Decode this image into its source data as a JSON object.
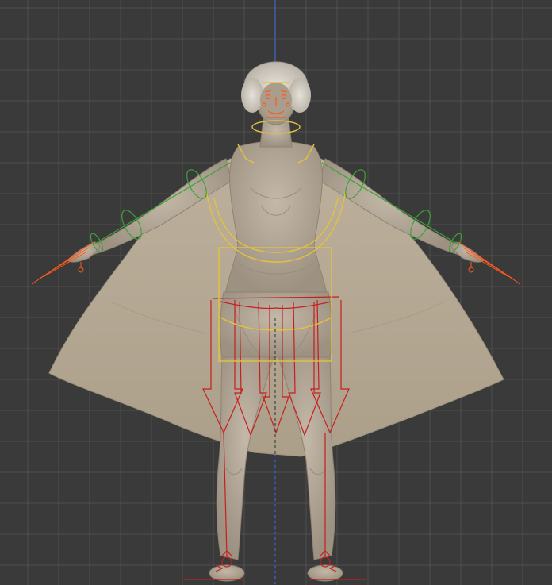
{
  "viewport": {
    "view": "front-orthographic",
    "background_color": "#3a3a3a",
    "grid_color": "#4f4f4f",
    "z_axis_color": "#3b5fa8"
  },
  "model": {
    "skin_color": "#b2a797",
    "cape_color": "#b6aa96",
    "hair_color": "#d9d4ca"
  },
  "rig": {
    "deform_color": "#c81e1e",
    "torso_control_color": "#e6c23a",
    "limb_control_color": "#3aa336",
    "face_control_color": "#ff5a1e"
  }
}
